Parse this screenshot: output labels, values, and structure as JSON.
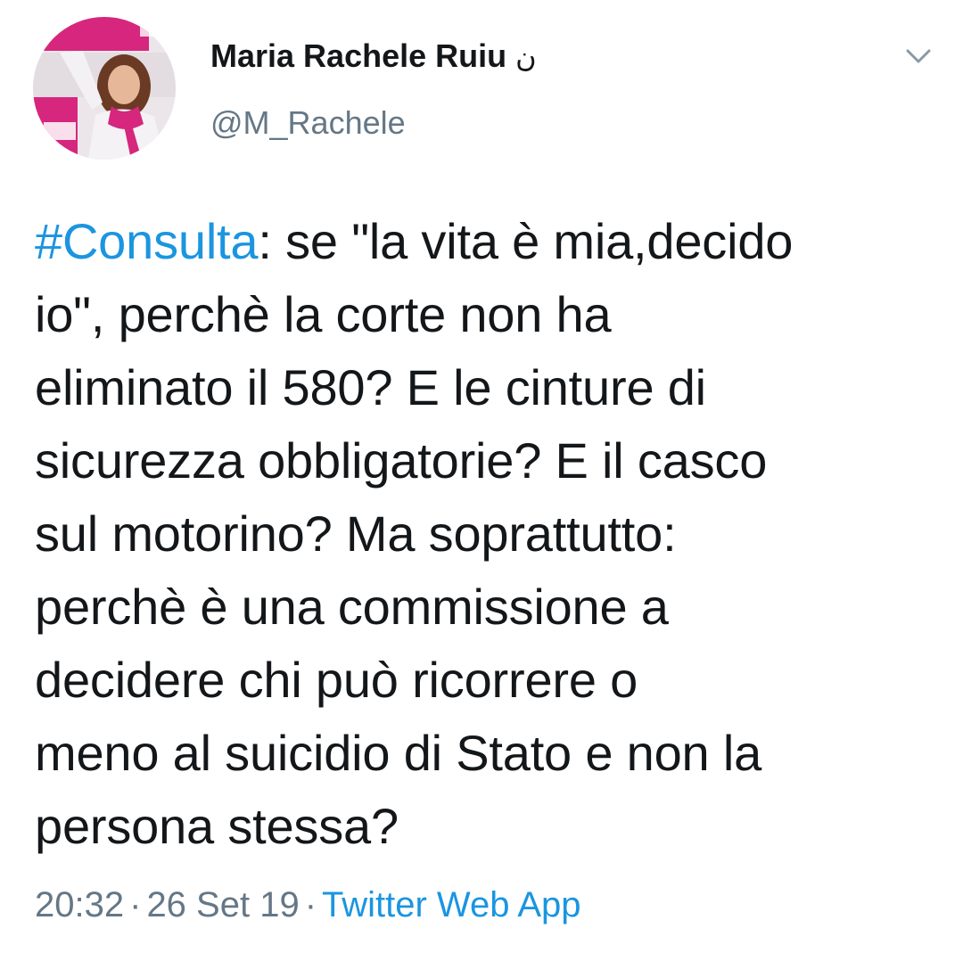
{
  "tweet": {
    "author": {
      "display_name": "Maria Rachele Ruiu",
      "name_symbol": "ن",
      "handle": "@M_Rachele"
    },
    "text": {
      "hashtag": "#Consulta",
      "lines": [
        ": se \"la vita è mia,decido",
        "io\", perchè la corte non ha",
        "eliminato il 580? E le cinture di",
        "sicurezza obbligatorie? E il casco",
        "sul motorino? Ma soprattutto:",
        "perchè è una commissione a",
        "decidere chi può ricorrere o",
        "meno al suicidio di Stato e non la",
        "persona stessa?"
      ]
    },
    "time": "20:32",
    "date": "26 Set 19",
    "separator": "·",
    "source": "Twitter Web App"
  },
  "icons": {
    "menu": "chevron-down-icon"
  },
  "colors": {
    "link": "#1b95e0",
    "secondary_text": "#657786",
    "primary_text": "#14171a",
    "avatar_accent": "#d6267d"
  }
}
